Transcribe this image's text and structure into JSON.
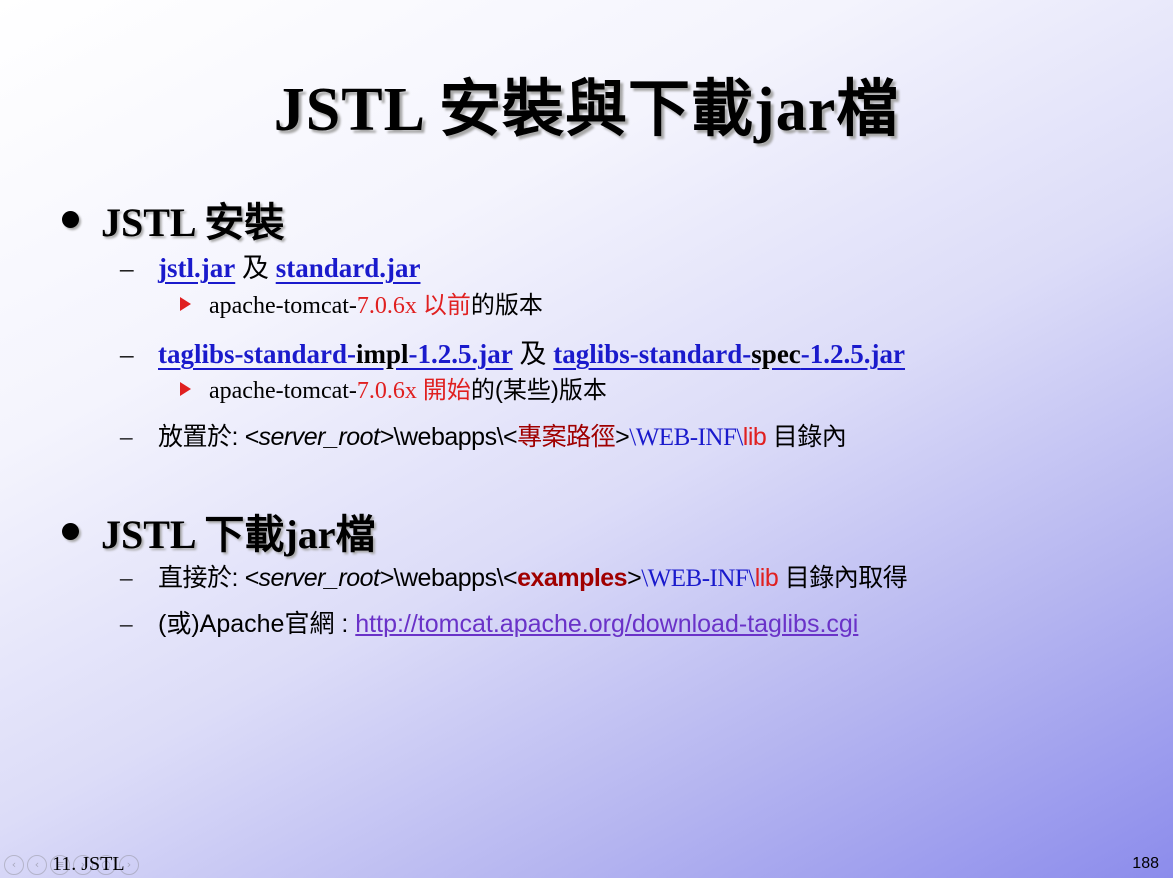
{
  "slide": {
    "title": "JSTL 安裝與下載jar檔",
    "footer_left": "11. JSTL",
    "page_number": "188"
  },
  "section1": {
    "heading": "JSTL 安裝",
    "item1": {
      "link_a": "jstl.jar",
      "and": "及",
      "link_b": "standard.jar",
      "sub": {
        "prefix": "apache-tomcat-",
        "version": "7.0.6x",
        "keyword": "以前",
        "suffix": "的版本"
      }
    },
    "item2": {
      "a1": "taglibs-standard-",
      "a2": "impl",
      "a3": "-1.2.5.jar",
      "and": "及",
      "b1": "taglibs-standard-",
      "b2": "spec",
      "b3": "-1.2.5.jar",
      "sub": {
        "prefix": "apache-tomcat-",
        "version": "7.0.6x",
        "keyword": "開始",
        "suffix": "的(某些)版本"
      }
    },
    "item3": {
      "label": "放置於: ",
      "server_root": "<server_root>",
      "path1": "\\webapps\\<",
      "project": "專案路徑",
      "path2": ">",
      "webinf": "\\WEB-INF\\",
      "lib": "lib",
      "suffix": " 目錄內"
    }
  },
  "section2": {
    "heading": "JSTL 下載jar檔",
    "item1": {
      "label": "直接於: ",
      "server_root": "<server_root>",
      "path1": "\\webapps\\<",
      "examples": "examples",
      "path2": ">",
      "webinf": "\\WEB-INF\\",
      "lib": "lib",
      "suffix": " 目錄內取得"
    },
    "item2": {
      "label": "(或)Apache官網 : ",
      "url": "http://tomcat.apache.org/download-taglibs.cgi"
    }
  },
  "colors": {
    "link": "#1a1acc",
    "accent_red": "#e02020",
    "dark_red": "#a00000",
    "url": "#6a32c8"
  }
}
